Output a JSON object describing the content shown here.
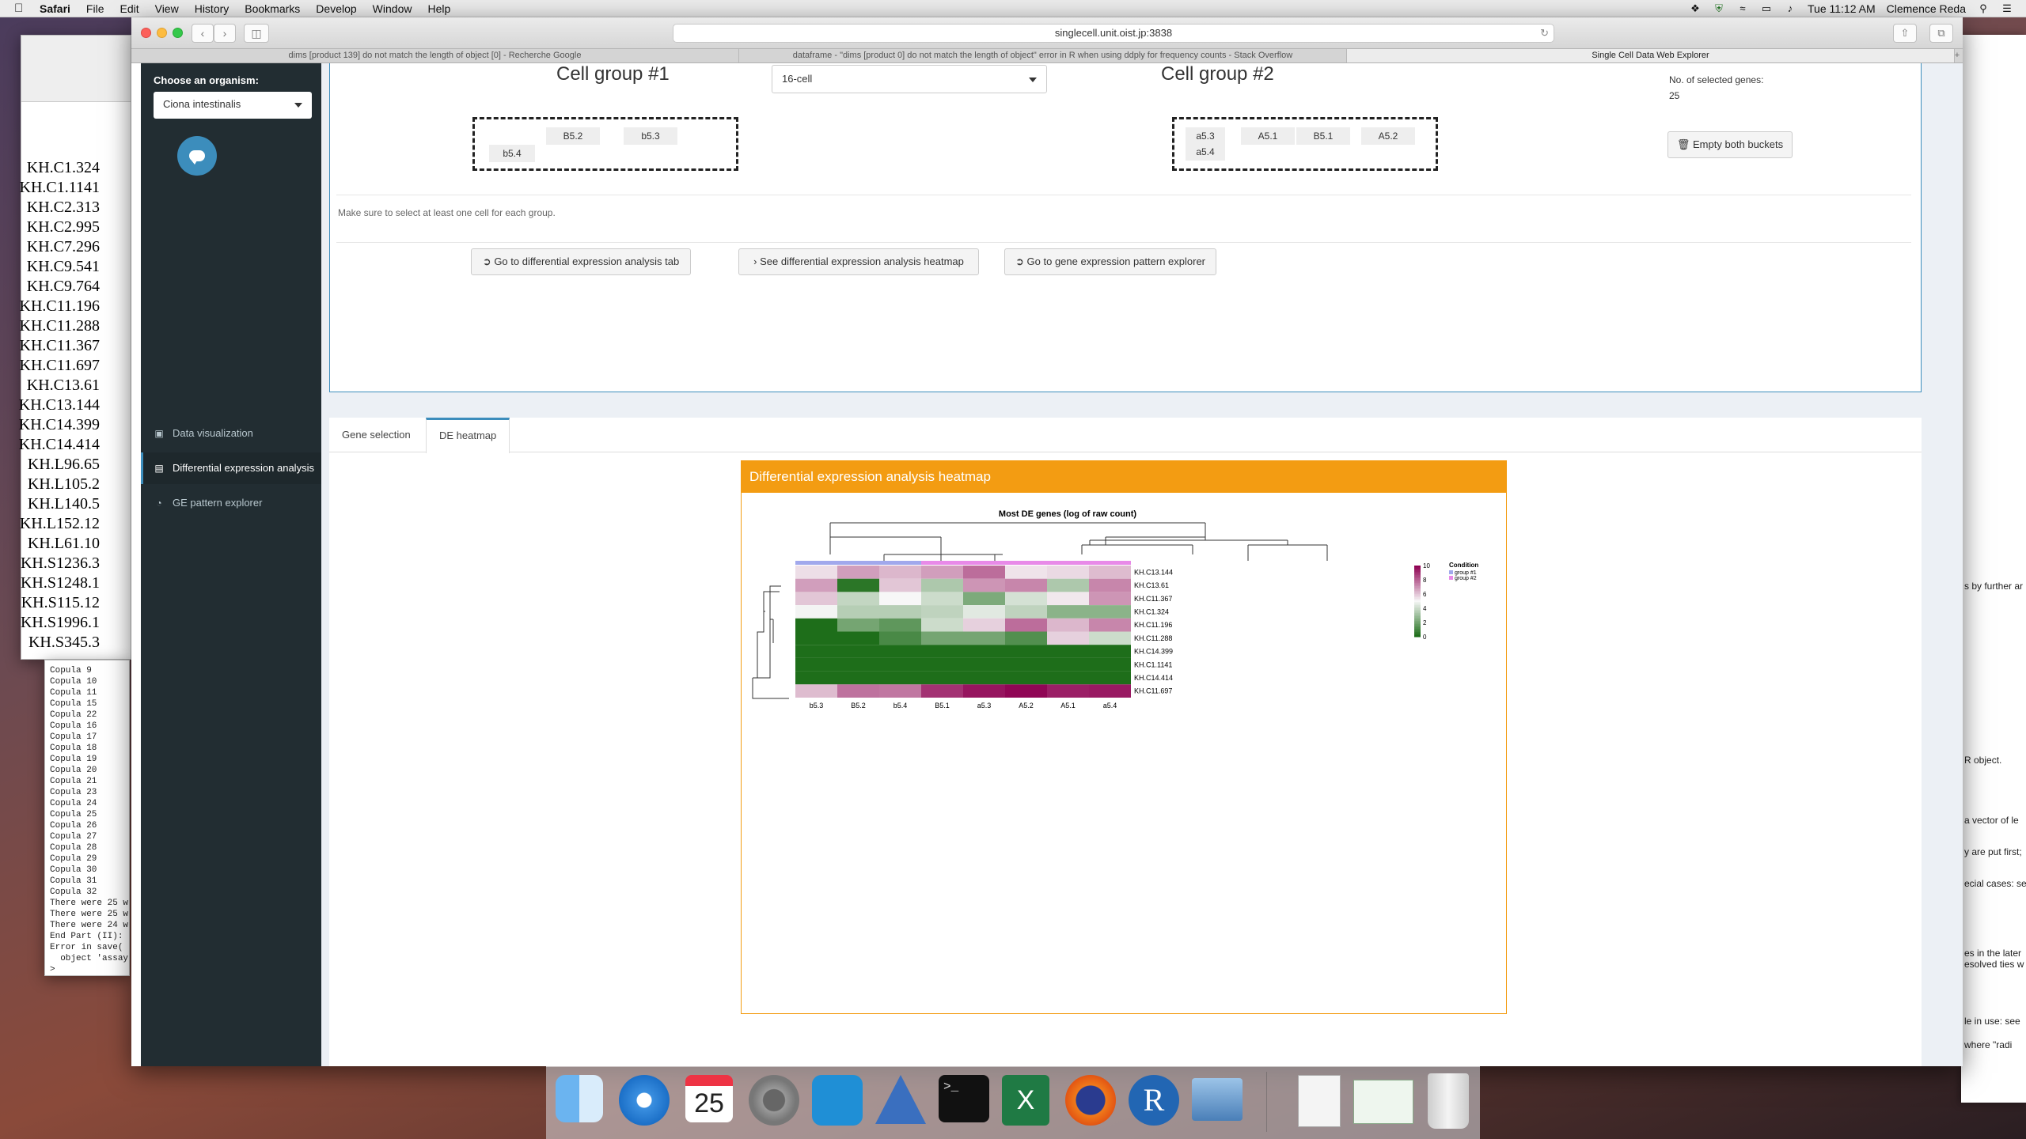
{
  "menubar": {
    "app": "Safari",
    "items": [
      "File",
      "Edit",
      "View",
      "History",
      "Bookmarks",
      "Develop",
      "Window",
      "Help"
    ],
    "clock": "Tue 11:12 AM",
    "user": "Clemence Reda"
  },
  "background": {
    "gene_list": [
      "KH.C1.324",
      "KH.C1.1141",
      "KH.C2.313",
      "KH.C2.995",
      "KH.C7.296",
      "KH.C9.541",
      "KH.C9.764",
      "KH.C11.196",
      "KH.C11.288",
      "KH.C11.367",
      "KH.C11.697",
      "KH.C13.61",
      "KH.C13.144",
      "KH.C14.399",
      "KH.C14.414",
      "KH.L96.65",
      "KH.L105.2",
      "KH.L140.5",
      "KH.L152.12",
      "KH.L61.10",
      "KH.S1236.3",
      "KH.S1248.1",
      "KH.S115.12",
      "KH.S1996.1",
      "KH.S345.3"
    ],
    "console_lines": [
      "Copula 9",
      "Copula 10",
      "Copula 11",
      "Copula 15",
      "Copula 22",
      "Copula 16",
      "Copula 17",
      "Copula 18",
      "Copula 19",
      "Copula 20",
      "Copula 21",
      "Copula 23",
      "Copula 24",
      "Copula 25",
      "Copula 26",
      "Copula 27",
      "Copula 28",
      "Copula 29",
      "Copula 30",
      "Copula 31",
      "Copula 32",
      "There were 25 w",
      "There were 25 w",
      "There were 24 w",
      "End Part (II):",
      "Error in save(",
      "  object 'assay",
      ">"
    ],
    "right_texts": [
      "s by further ar",
      "R object.",
      "a vector of le",
      "y are put first;",
      "ecial cases: se",
      "es in the later",
      "esolved ties w",
      "le in use: see",
      "where \"radi"
    ]
  },
  "browser": {
    "url": "singlecell.unit.oist.jp:3838",
    "tabs": [
      {
        "label": "dims [product 139] do not match the length of object [0] - Recherche Google",
        "active": false
      },
      {
        "label": "dataframe - \"dims [product 0] do not match the length of object\" error in R when using ddply for frequency counts - Stack Overflow",
        "active": false
      },
      {
        "label": "Single Cell Data Web Explorer",
        "active": true
      }
    ]
  },
  "sidebar": {
    "organism_label": "Choose an organism:",
    "organism_value": "Ciona intestinalis",
    "nav": [
      {
        "label": "Data visualization",
        "icon": "image-icon",
        "active": false
      },
      {
        "label": "Differential expression analysis",
        "icon": "bar-chart-icon",
        "active": true
      },
      {
        "label": "GE pattern explorer",
        "icon": "pie-chart-icon",
        "active": false
      }
    ]
  },
  "groups": {
    "group1_title": "Cell group #1",
    "group2_title": "Cell group #2",
    "stage_value": "16-cell",
    "group1_cells": [
      "B5.2",
      "b5.3",
      "b5.4"
    ],
    "group2_cells": [
      "a5.3",
      "A5.1",
      "B5.1",
      "A5.2",
      "a5.4"
    ],
    "selected_genes_label": "No. of selected genes:",
    "selected_genes_value": "25",
    "empty_button": "Empty both buckets",
    "warning": "Make sure to select at least one cell for each group.",
    "actions": [
      {
        "label": "Go to differential expression analysis tab",
        "icon": "arrow-circle-icon"
      },
      {
        "label": "See differential expression analysis heatmap",
        "icon": "chevron-right-icon"
      },
      {
        "label": "Go to gene expression pattern explorer",
        "icon": "arrow-circle-icon"
      }
    ]
  },
  "panel_tabs": [
    {
      "label": "Gene selection",
      "active": false
    },
    {
      "label": "DE heatmap",
      "active": true
    }
  ],
  "heatmap_box": {
    "header": "Differential expression analysis heatmap"
  },
  "chart_data": {
    "type": "heatmap",
    "title": "Most DE genes (log of raw count)",
    "columns": [
      "b5.3",
      "B5.2",
      "b5.4",
      "B5.1",
      "a5.3",
      "A5.2",
      "A5.1",
      "a5.4"
    ],
    "column_condition": [
      "group #1",
      "group #1",
      "group #1",
      "group #2",
      "group #2",
      "group #2",
      "group #2",
      "group #2"
    ],
    "rows": [
      "KH.C13.144",
      "KH.C13.61",
      "KH.C11.367",
      "KH.C1.324",
      "KH.C11.196",
      "KH.C11.288",
      "KH.C14.399",
      "KH.C1.1141",
      "KH.C14.414",
      "KH.C11.697"
    ],
    "values": [
      [
        5.5,
        6.8,
        6.3,
        6.8,
        7.8,
        5.4,
        5.6,
        6.2
      ],
      [
        6.8,
        0.3,
        6.0,
        3.3,
        7.0,
        7.3,
        3.3,
        7.3
      ],
      [
        6.0,
        3.8,
        5.0,
        4.0,
        2.2,
        4.2,
        5.3,
        7.0
      ],
      [
        4.9,
        3.5,
        3.5,
        3.7,
        4.5,
        3.7,
        2.5,
        2.5
      ],
      [
        0.0,
        2.0,
        1.5,
        4.0,
        5.8,
        7.8,
        6.3,
        7.3
      ],
      [
        0.0,
        0.0,
        1.0,
        2.0,
        2.0,
        1.2,
        5.8,
        4.0
      ],
      [
        0.0,
        0.0,
        0.0,
        0.0,
        0.0,
        0.0,
        0.0,
        0.0
      ],
      [
        0.0,
        0.0,
        0.0,
        0.0,
        0.0,
        0.0,
        0.0,
        0.0
      ],
      [
        0.0,
        0.0,
        0.0,
        0.0,
        0.0,
        0.0,
        0.0,
        0.0
      ],
      [
        6.2,
        7.7,
        7.6,
        9.0,
        9.6,
        9.9,
        9.4,
        9.5
      ]
    ],
    "color_scale": {
      "min": 0,
      "max": 10,
      "low": "#1e6e1a",
      "mid": "#f7f7f7",
      "high": "#8e0152"
    },
    "colorbar_ticks": [
      0,
      2,
      4,
      6,
      8,
      10
    ],
    "legend_title": "Condition",
    "legend_entries": [
      {
        "name": "group #1",
        "color": "#a1a8ec"
      },
      {
        "name": "group #2",
        "color": "#e88ae8"
      }
    ]
  }
}
